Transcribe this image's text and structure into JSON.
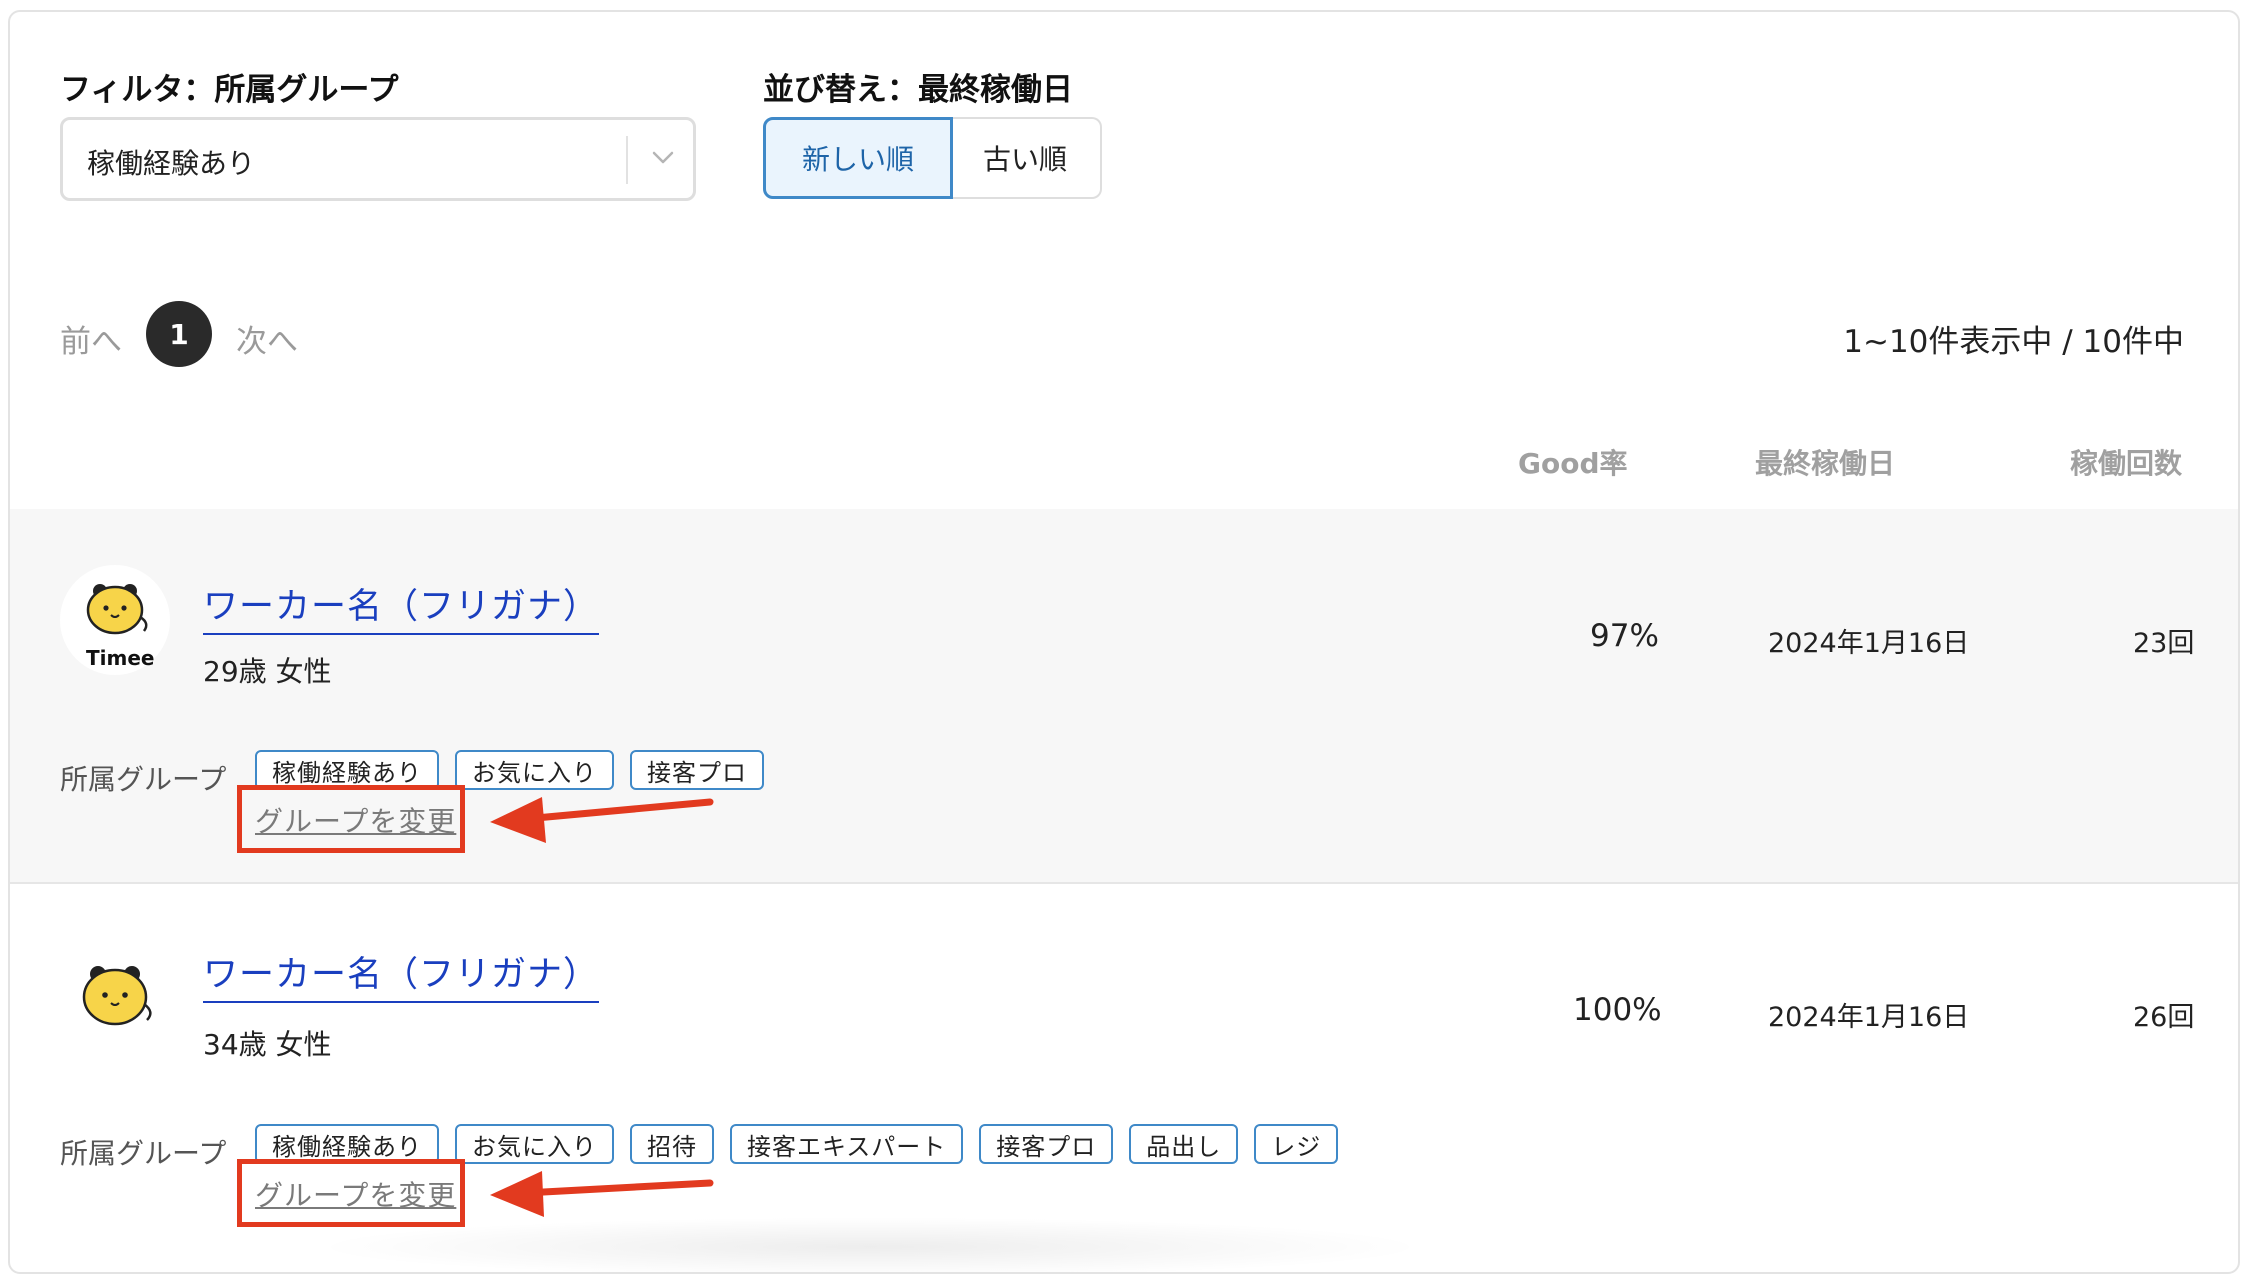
{
  "filter": {
    "label": "フィルタ：所属グループ",
    "selected": "稼働経験あり"
  },
  "sort": {
    "label": "並び替え：最終稼働日",
    "options": [
      "新しい順",
      "古い順"
    ],
    "active": "新しい順"
  },
  "pagination": {
    "prev": "前へ",
    "current": "1",
    "next": "次へ",
    "summary": "1~10件表示中 / 10件中"
  },
  "columns": {
    "good_rate": "Good率",
    "last_work_date": "最終稼働日",
    "work_count": "稼働回数"
  },
  "workers": [
    {
      "name": "ワーカー名（フリガナ）",
      "profile": "29歳 女性",
      "avatar_text": "Timee",
      "good_rate": "97%",
      "last_work_date": "2024年1月16日",
      "work_count": "23回",
      "group_label": "所属グループ",
      "tags": [
        "稼働経験あり",
        "お気に入り",
        "接客プロ"
      ],
      "change_group": "グループを変更"
    },
    {
      "name": "ワーカー名（フリガナ）",
      "profile": "34歳 女性",
      "good_rate": "100%",
      "last_work_date": "2024年1月16日",
      "work_count": "26回",
      "group_label": "所属グループ",
      "tags": [
        "稼働経験あり",
        "お気に入り",
        "招待",
        "接客エキスパート",
        "接客プロ",
        "品出し",
        "レジ"
      ],
      "change_group": "グループを変更"
    }
  ],
  "colors": {
    "link": "#1a3fbf",
    "accent": "#3f89c8",
    "highlight": "#e23a1f"
  }
}
